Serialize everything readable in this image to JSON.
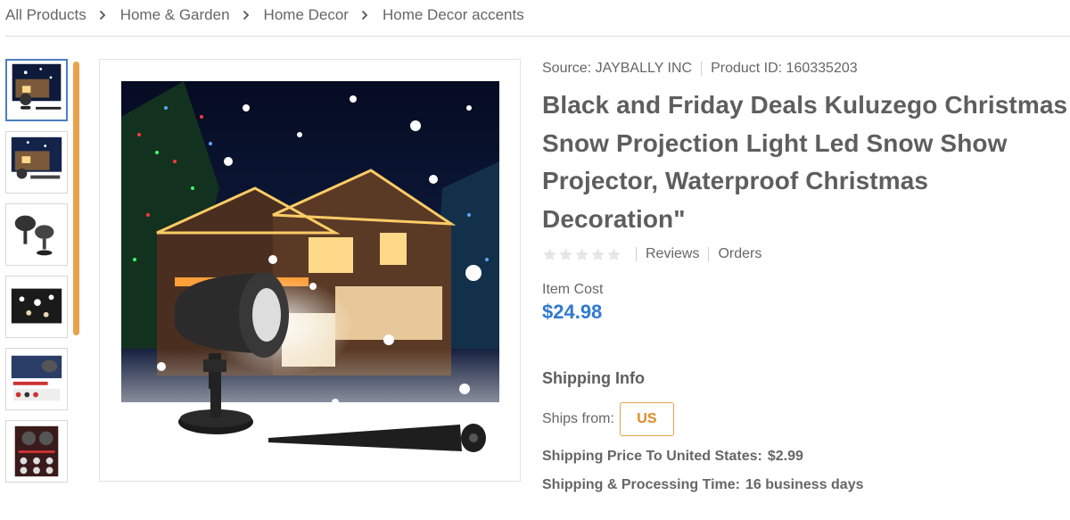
{
  "breadcrumb": [
    "All Products",
    "Home & Garden",
    "Home Decor",
    "Home Decor accents"
  ],
  "product": {
    "source_label": "Source: JAYBALLY INC",
    "id_label": "Product ID: 160335203",
    "title": "Black and Friday Deals Kuluzego Christmas Snow Projection Light Led Snow Show Projector, Waterproof Christmas Decoration\"",
    "reviews_label": "Reviews",
    "orders_label": "Orders",
    "rating": 0,
    "item_cost_label": "Item Cost",
    "price": "$24.98"
  },
  "shipping": {
    "heading": "Shipping Info",
    "ships_from_label": "Ships from:",
    "country": "US",
    "price_label": "Shipping Price To United States:",
    "price_value": "$2.99",
    "time_label": "Shipping & Processing Time:",
    "time_value": "16 business days"
  },
  "colors": {
    "accent": "#e8a24a",
    "price": "#2e7ad1",
    "active_thumb_border": "#4a7fbf"
  },
  "icons": [
    "chevron-right-icon",
    "star-icon"
  ]
}
